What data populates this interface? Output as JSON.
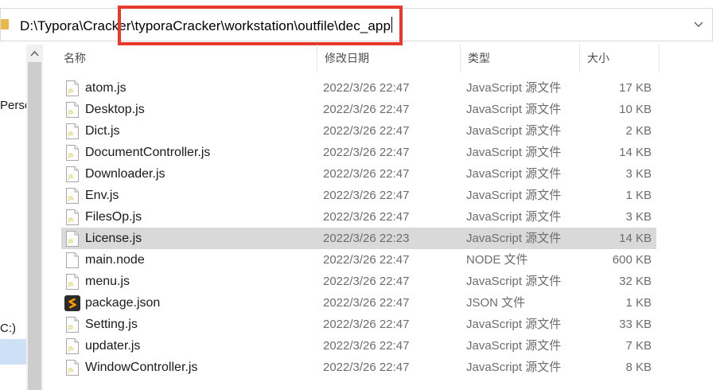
{
  "address": {
    "path": "D:\\Typora\\Cracker\\typoraCracker\\workstation\\outfile\\dec_app",
    "highlight_color": "#e8392f",
    "folder_icon": "folder-icon",
    "dropdown_icon": "chevron-down-icon"
  },
  "nav": {
    "items": [
      {
        "label": "Perso"
      },
      {
        "label": "C:)"
      }
    ]
  },
  "columns": {
    "name": "名称",
    "date": "修改日期",
    "type": "类型",
    "size": "大小"
  },
  "files": [
    {
      "name": "atom.js",
      "date": "2022/3/26 22:47",
      "type": "JavaScript 源文件",
      "size": "17 KB",
      "icon": "js"
    },
    {
      "name": "Desktop.js",
      "date": "2022/3/26 22:47",
      "type": "JavaScript 源文件",
      "size": "10 KB",
      "icon": "js"
    },
    {
      "name": "Dict.js",
      "date": "2022/3/26 22:47",
      "type": "JavaScript 源文件",
      "size": "2 KB",
      "icon": "js"
    },
    {
      "name": "DocumentController.js",
      "date": "2022/3/26 22:47",
      "type": "JavaScript 源文件",
      "size": "14 KB",
      "icon": "js"
    },
    {
      "name": "Downloader.js",
      "date": "2022/3/26 22:47",
      "type": "JavaScript 源文件",
      "size": "3 KB",
      "icon": "js"
    },
    {
      "name": "Env.js",
      "date": "2022/3/26 22:47",
      "type": "JavaScript 源文件",
      "size": "1 KB",
      "icon": "js"
    },
    {
      "name": "FilesOp.js",
      "date": "2022/3/26 22:47",
      "type": "JavaScript 源文件",
      "size": "3 KB",
      "icon": "js"
    },
    {
      "name": "License.js",
      "date": "2022/3/26 22:23",
      "type": "JavaScript 源文件",
      "size": "14 KB",
      "icon": "js",
      "selected": true
    },
    {
      "name": "main.node",
      "date": "2022/3/26 22:47",
      "type": "NODE 文件",
      "size": "600 KB",
      "icon": "blank"
    },
    {
      "name": "menu.js",
      "date": "2022/3/26 22:47",
      "type": "JavaScript 源文件",
      "size": "32 KB",
      "icon": "js"
    },
    {
      "name": "package.json",
      "date": "2022/3/26 22:47",
      "type": "JSON 文件",
      "size": "1 KB",
      "icon": "json"
    },
    {
      "name": "Setting.js",
      "date": "2022/3/26 22:47",
      "type": "JavaScript 源文件",
      "size": "33 KB",
      "icon": "js"
    },
    {
      "name": "updater.js",
      "date": "2022/3/26 22:47",
      "type": "JavaScript 源文件",
      "size": "7 KB",
      "icon": "js"
    },
    {
      "name": "WindowController.js",
      "date": "2022/3/26 22:47",
      "type": "JavaScript 源文件",
      "size": "8 KB",
      "icon": "js"
    }
  ]
}
